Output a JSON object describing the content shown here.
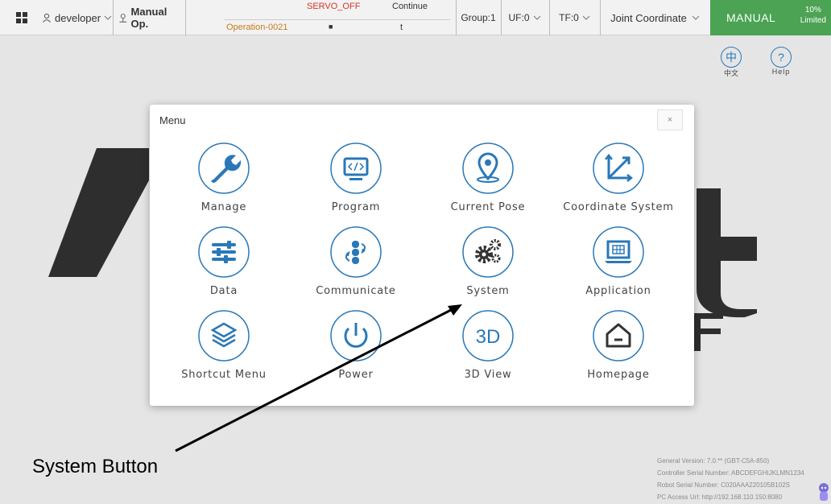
{
  "topbar": {
    "user": "developer",
    "mode_op": "Manual Op.",
    "servo_status": "SERVO_OFF",
    "operation": "Operation-0021",
    "run_mode": "Continue",
    "step_symbol": "■",
    "step_value": "t",
    "group": "Group:1",
    "uf": "UF:0",
    "tf": "TF:0",
    "coordinate": "Joint Coordinate",
    "manual": "MANUAL",
    "speed_pct": "10%",
    "speed_mode": "Limited"
  },
  "toplinks": {
    "language_label": "中文",
    "language_icon_char": "中",
    "help_label": "Help",
    "help_icon_char": "?"
  },
  "modal": {
    "title": "Menu",
    "close_symbol": "×",
    "items": [
      {
        "label": "Manage",
        "icon": "wrench-icon"
      },
      {
        "label": "Program",
        "icon": "monitor-code-icon"
      },
      {
        "label": "Current Pose",
        "icon": "location-pin-icon"
      },
      {
        "label": "Coordinate System",
        "icon": "axes-icon"
      },
      {
        "label": "Data",
        "icon": "sliders-icon"
      },
      {
        "label": "Communicate",
        "icon": "exchange-icon"
      },
      {
        "label": "System",
        "icon": "gears-icon"
      },
      {
        "label": "Application",
        "icon": "laptop-icon"
      },
      {
        "label": "Shortcut Menu",
        "icon": "layers-icon"
      },
      {
        "label": "Power",
        "icon": "power-icon"
      },
      {
        "label": "3D View",
        "icon": "3d-icon"
      },
      {
        "label": "Homepage",
        "icon": "home-icon"
      }
    ],
    "three_d_text": "3D"
  },
  "annotation": {
    "label": "System Button"
  },
  "info": {
    "general_version": "General Version:  7.0.** (GBT-C5A-850)",
    "controller_serial": "Controller Serial Number:  ABCDEFGHIJKLMN1234",
    "robot_serial": "Robot Serial Number:  C020AAA220105B102S",
    "pc_access": "PC Access Url:  http://192.168.110.150:8080"
  },
  "colors": {
    "accent": "#2a78b7",
    "manual_bg": "#4ba353",
    "servo_off": "#d9342b",
    "operation": "#c87b1e"
  }
}
